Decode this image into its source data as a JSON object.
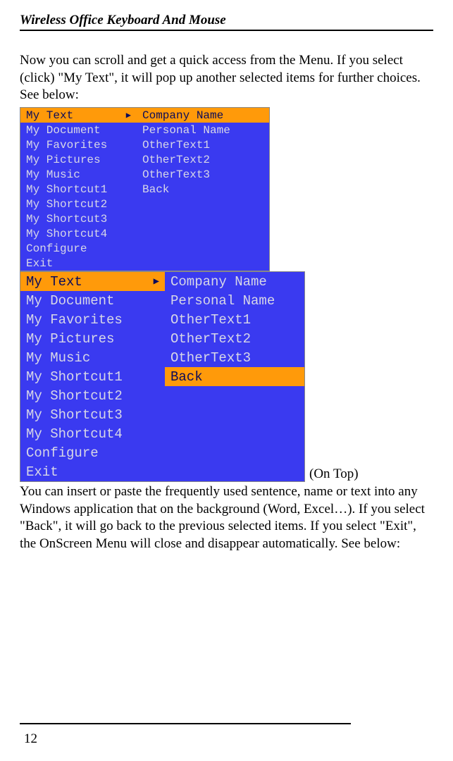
{
  "header": {
    "title": "Wireless Office Keyboard And Mouse"
  },
  "para1": "Now you can scroll and get a quick access from the Menu. If you select (click) \"My Text\", it will pop up another selected items for further choices. See below:",
  "menu1": {
    "left": [
      {
        "label": "My Text",
        "sel": true,
        "arrow": true
      },
      {
        "label": "My Document"
      },
      {
        "label": "My Favorites"
      },
      {
        "label": "My Pictures"
      },
      {
        "label": "My Music"
      },
      {
        "label": "My Shortcut1"
      },
      {
        "label": "My Shortcut2"
      },
      {
        "label": "My Shortcut3"
      },
      {
        "label": "My Shortcut4"
      },
      {
        "label": "Configure"
      },
      {
        "label": "Exit"
      }
    ],
    "right": [
      {
        "label": "Company Name",
        "sel": true
      },
      {
        "label": "Personal Name"
      },
      {
        "label": "OtherText1"
      },
      {
        "label": "OtherText2"
      },
      {
        "label": "OtherText3"
      },
      {
        "label": "Back"
      }
    ]
  },
  "menu2": {
    "left": [
      {
        "label": "My Text",
        "sel": true,
        "arrow": true
      },
      {
        "label": "My Document"
      },
      {
        "label": "My Favorites"
      },
      {
        "label": "My Pictures"
      },
      {
        "label": "My Music"
      },
      {
        "label": "My Shortcut1"
      },
      {
        "label": "My Shortcut2"
      },
      {
        "label": "My Shortcut3"
      },
      {
        "label": "My Shortcut4"
      },
      {
        "label": "Configure"
      },
      {
        "label": "Exit"
      }
    ],
    "right": [
      {
        "label": "Company Name"
      },
      {
        "label": "Personal Name"
      },
      {
        "label": "OtherText1"
      },
      {
        "label": "OtherText2"
      },
      {
        "label": "OtherText3"
      },
      {
        "label": "Back",
        "sel": true
      }
    ]
  },
  "onTop": "(On Top)",
  "para2": "You can insert or paste the frequently used sentence, name or text into any Windows application that on the background (Word, Excel…). If you select \"Back\", it will go back to the previous selected items. If you select \"Exit\", the OnScreen Menu will close and disappear automatically. See below:",
  "pageNumber": "12"
}
